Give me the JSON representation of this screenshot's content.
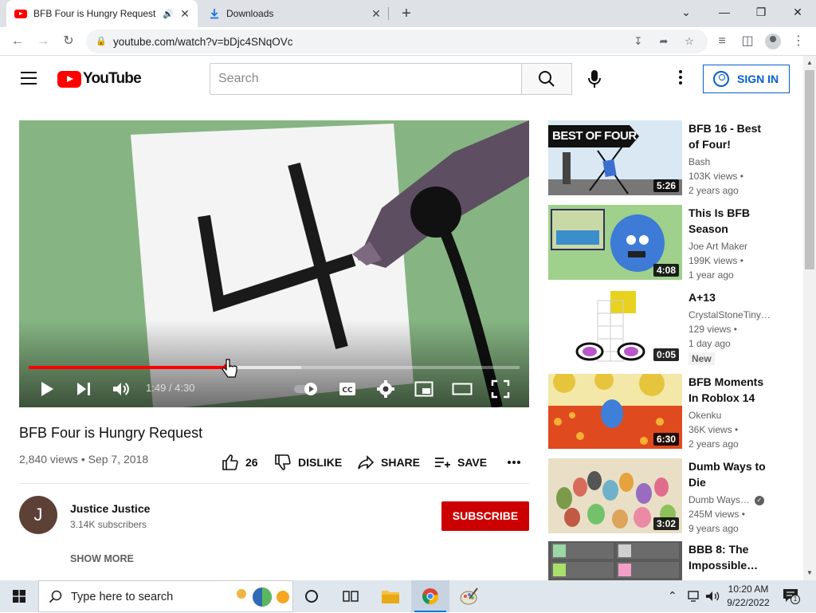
{
  "browser": {
    "tabs": [
      {
        "title": "BFB Four is Hungry Request",
        "active": true
      },
      {
        "title": "Downloads",
        "active": false
      }
    ],
    "url": "youtube.com/watch?v=bDjc4SNqOVc"
  },
  "youtube": {
    "logo_text": "YouTube",
    "search_placeholder": "Search",
    "sign_in_label": "SIGN IN"
  },
  "player": {
    "time_display": "1:49 / 4:30",
    "progress_fraction": 0.404,
    "buffered_fraction": 0.555
  },
  "video": {
    "title": "BFB Four is Hungry Request",
    "meta": "2,840 views • Sep 7, 2018",
    "likes": "26",
    "dislike_label": "DISLIKE",
    "share_label": "SHARE",
    "save_label": "SAVE",
    "channel": {
      "name": "Justice Justice",
      "subscribers": "3.14K subscribers",
      "initial": "J"
    },
    "subscribe_label": "SUBSCRIBE",
    "show_more_label": "SHOW MORE"
  },
  "recommendations": [
    {
      "title": "BFB 16 - Best of Four!",
      "channel": "Bash",
      "views": "103K views •",
      "ago": "2 years ago",
      "duration": "5:26",
      "thumb_text": "BEST OF FOUR",
      "verified": false,
      "badge": ""
    },
    {
      "title": "This Is BFB Season Recap…",
      "channel": "Joe Art Maker",
      "views": "199K views •",
      "ago": "1 year ago",
      "duration": "4:08",
      "verified": false,
      "badge": ""
    },
    {
      "title": "A+13",
      "channel": "CrystalStoneTiny…",
      "views": "129 views •",
      "ago": "1 day ago",
      "duration": "0:05",
      "verified": false,
      "badge": "New"
    },
    {
      "title": "BFB Moments In Roblox 14",
      "channel": "Okenku",
      "views": "36K views •",
      "ago": "2 years ago",
      "duration": "6:30",
      "verified": false,
      "badge": ""
    },
    {
      "title": "Dumb Ways to Die",
      "channel": "Dumb Ways…",
      "views": "245M views •",
      "ago": "9 years ago",
      "duration": "3:02",
      "verified": true,
      "badge": ""
    },
    {
      "title": "BBB 8: The Impossible…",
      "channel": "",
      "views": "",
      "ago": "",
      "duration": "",
      "verified": false,
      "badge": ""
    }
  ],
  "taskbar": {
    "search_placeholder": "Type here to search",
    "time": "10:20 AM",
    "date": "9/22/2022",
    "notification_count": "1"
  },
  "colors": {
    "youtube_red": "#ff0000",
    "subscribe_red": "#cc0000",
    "link_blue": "#065fd4"
  }
}
